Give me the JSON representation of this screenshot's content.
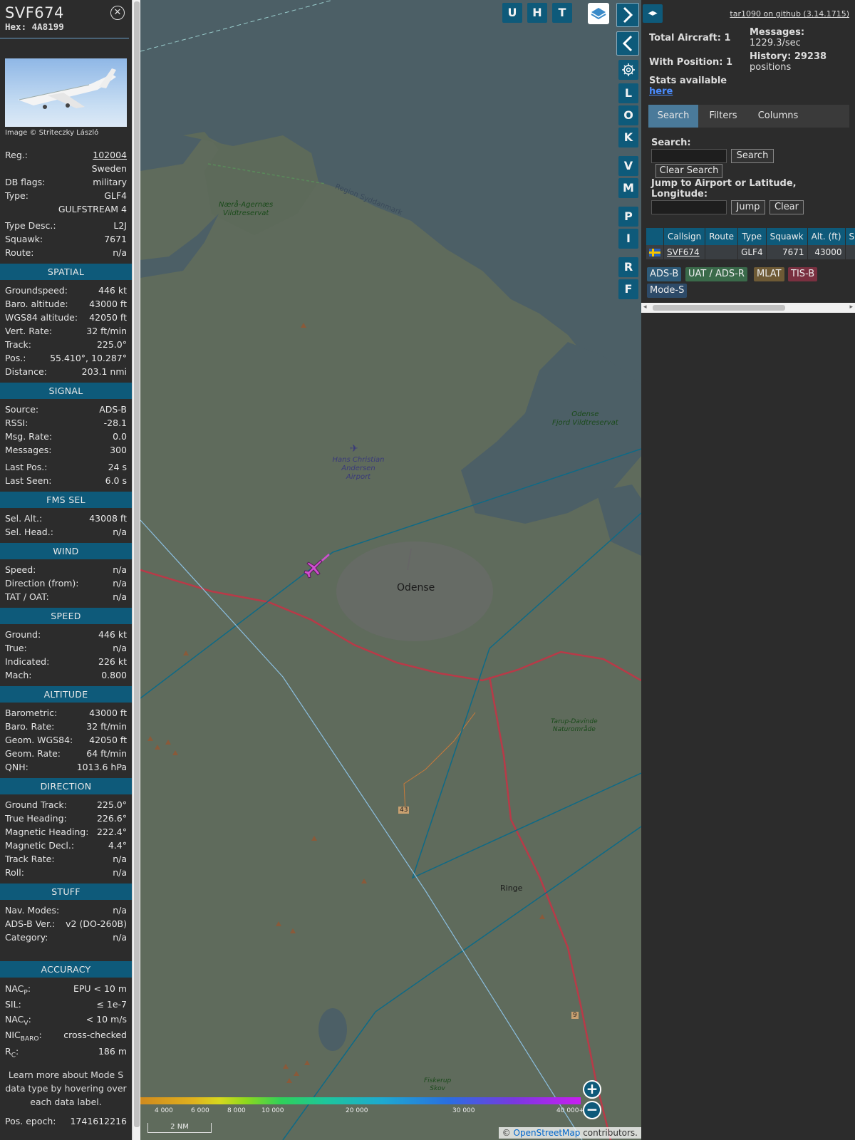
{
  "info": {
    "callsign": "SVF674",
    "hex": "Hex: 4A8199",
    "close_icon": "close-icon",
    "image_credit": "Image © Striteczky László",
    "registration": {
      "rows": [
        {
          "k": "Reg.:",
          "v": "102004"
        },
        {
          "k": "",
          "v": "Sweden"
        },
        {
          "k": "DB flags:",
          "v": "military"
        },
        {
          "k": "Type:",
          "v": "GLF4"
        },
        {
          "k": "",
          "v": "GULFSTREAM 4"
        }
      ]
    },
    "type_rows": [
      {
        "k": "Type Desc.:",
        "v": "L2J"
      },
      {
        "k": "Squawk:",
        "v": "7671"
      },
      {
        "k": "Route:",
        "v": "n/a"
      }
    ],
    "sections": {
      "spatial": {
        "title": "SPATIAL",
        "rows": [
          {
            "k": "Groundspeed:",
            "v": "446 kt"
          },
          {
            "k": "Baro. altitude:",
            "v": "43000 ft"
          },
          {
            "k": "WGS84 altitude:",
            "v": "42050 ft"
          },
          {
            "k": "Vert. Rate:",
            "v": "32 ft/min"
          },
          {
            "k": "Track:",
            "v": "225.0°"
          },
          {
            "k": "Pos.:",
            "v": "55.410°, 10.287°"
          },
          {
            "k": "Distance:",
            "v": "203.1 nmi"
          }
        ]
      },
      "signal": {
        "title": "SIGNAL",
        "rows": [
          {
            "k": "Source:",
            "v": "ADS-B"
          },
          {
            "k": "RSSI:",
            "v": "-28.1"
          },
          {
            "k": "Msg. Rate:",
            "v": "0.0"
          },
          {
            "k": "Messages:",
            "v": "300"
          }
        ],
        "rows2": [
          {
            "k": "Last Pos.:",
            "v": "24 s"
          },
          {
            "k": "Last Seen:",
            "v": "6.0 s"
          }
        ]
      },
      "fms": {
        "title": "FMS SEL",
        "rows": [
          {
            "k": "Sel. Alt.:",
            "v": "43008 ft"
          },
          {
            "k": "Sel. Head.:",
            "v": "n/a"
          }
        ]
      },
      "wind": {
        "title": "WIND",
        "rows": [
          {
            "k": "Speed:",
            "v": "n/a"
          },
          {
            "k": "Direction (from):",
            "v": "n/a"
          },
          {
            "k": "TAT / OAT:",
            "v": "n/a"
          }
        ]
      },
      "speed": {
        "title": "SPEED",
        "rows": [
          {
            "k": "Ground:",
            "v": "446 kt"
          },
          {
            "k": "True:",
            "v": "n/a"
          },
          {
            "k": "Indicated:",
            "v": "226 kt"
          },
          {
            "k": "Mach:",
            "v": "0.800"
          }
        ]
      },
      "altitude": {
        "title": "ALTITUDE",
        "rows": [
          {
            "k": "Barometric:",
            "v": "43000 ft"
          },
          {
            "k": "Baro. Rate:",
            "v": "32 ft/min"
          },
          {
            "k": "Geom. WGS84:",
            "v": "42050 ft"
          },
          {
            "k": "Geom. Rate:",
            "v": "64 ft/min"
          },
          {
            "k": "QNH:",
            "v": "1013.6 hPa"
          }
        ]
      },
      "direction": {
        "title": "DIRECTION",
        "rows": [
          {
            "k": "Ground Track:",
            "v": "225.0°"
          },
          {
            "k": "True Heading:",
            "v": "226.6°"
          },
          {
            "k": "Magnetic Heading:",
            "v": "222.4°"
          },
          {
            "k": "Magnetic Decl.:",
            "v": "4.4°"
          },
          {
            "k": "Track Rate:",
            "v": "n/a"
          },
          {
            "k": "Roll:",
            "v": "n/a"
          }
        ]
      },
      "stuff": {
        "title": "STUFF",
        "rows": [
          {
            "k": "Nav. Modes:",
            "v": "n/a"
          },
          {
            "k": "ADS-B Ver.:",
            "v": "v2 (DO-260B)"
          },
          {
            "k": "Category:",
            "v": "n/a"
          }
        ]
      },
      "accuracy": {
        "title": "ACCURACY",
        "nacp_k": "NAC",
        "nacp_sub": "P",
        "nacp_v": "EPU < 10 m",
        "sil_k": "SIL:",
        "sil_v": "≤ 1e-7",
        "nacv_k": "NAC",
        "nacv_sub": "V",
        "nacv_v": "< 10 m/s",
        "nic_k": "NIC",
        "nic_sub": "BARO",
        "nic_v": "cross-checked",
        "rc_k": "R",
        "rc_sub": "C",
        "rc_v": "186 m"
      }
    },
    "note": "Learn more about Mode S data type by hovering over each data label.",
    "epoch_k": "Pos. epoch:",
    "epoch_v": "1741612216"
  },
  "map": {
    "buttons": {
      "u": "U",
      "h": "H",
      "t": "T",
      "l": "L",
      "o": "O",
      "k": "K",
      "v": "V",
      "m": "M",
      "p": "P",
      "i": "I",
      "r": "R",
      "f": "F"
    },
    "labels": {
      "odense": "Odense",
      "ringe": "Ringe",
      "airport1": "Hans Christian",
      "airport2": "Andersen",
      "airport3": "Airport",
      "nera1": "Nærå-Agernæs",
      "nera2": "Vildtreservat",
      "region": "Region Syddanmark",
      "fjord1": "Odense",
      "fjord2": "Fjord Vildtreservat",
      "tarup1": "Tarup-Davinde",
      "tarup2": "Naturområde",
      "faskerup1": "Fiskerup",
      "faskerup2": "Skov",
      "road43": "43",
      "road9": "9"
    },
    "colorbar_labels": [
      "4 000",
      "6 000",
      "8 000",
      "10 000",
      "20 000",
      "30 000",
      "40 000+"
    ],
    "scale": "2 NM",
    "attribution_prefix": "© ",
    "attribution_link": "OpenStreetMap",
    "attribution_suffix": " contributors.",
    "colors": {
      "water": "#4a5f66",
      "land": "#5d6a5a",
      "track": "#0e6a86",
      "road": "#b83a48",
      "aircraft": "#d050d0"
    }
  },
  "right": {
    "github": "tar1090 on github (3.14.1715)",
    "total_aircraft": "Total Aircraft: 1",
    "with_position": "With Position: 1",
    "stats_avail": "Stats available",
    "stats_link": "here",
    "messages_l1": "Messages:",
    "messages_l2": "1229.3/sec",
    "history_l1": "History: 29238",
    "history_l2": "positions",
    "tabs": [
      "Search",
      "Filters",
      "Columns"
    ],
    "search_label": "Search:",
    "search_button": "Search",
    "clear_search": "Clear Search",
    "jump_label_l1": "Jump to Airport or Latitude,",
    "jump_label_l2": "Longitude:",
    "jump_button": "Jump",
    "clear_button": "Clear",
    "table": {
      "headers": [
        "",
        "Callsign",
        "Route",
        "Type",
        "Squawk",
        "Alt. (ft)",
        "Spd."
      ],
      "row": {
        "callsign": "SVF674",
        "route": "",
        "type": "GLF4",
        "squawk": "7671",
        "alt": "43000",
        "spd": ""
      }
    },
    "sources": [
      {
        "label": "ADS-B",
        "color": "#2d5a78"
      },
      {
        "label": "UAT / ADS-R",
        "color": "#3a6a4a"
      },
      {
        "label": "MLAT",
        "color": "#6e5a35"
      },
      {
        "label": "TIS-B",
        "color": "#7a3040"
      },
      {
        "label": "Mode-S",
        "color": "#2d4a68"
      }
    ]
  }
}
